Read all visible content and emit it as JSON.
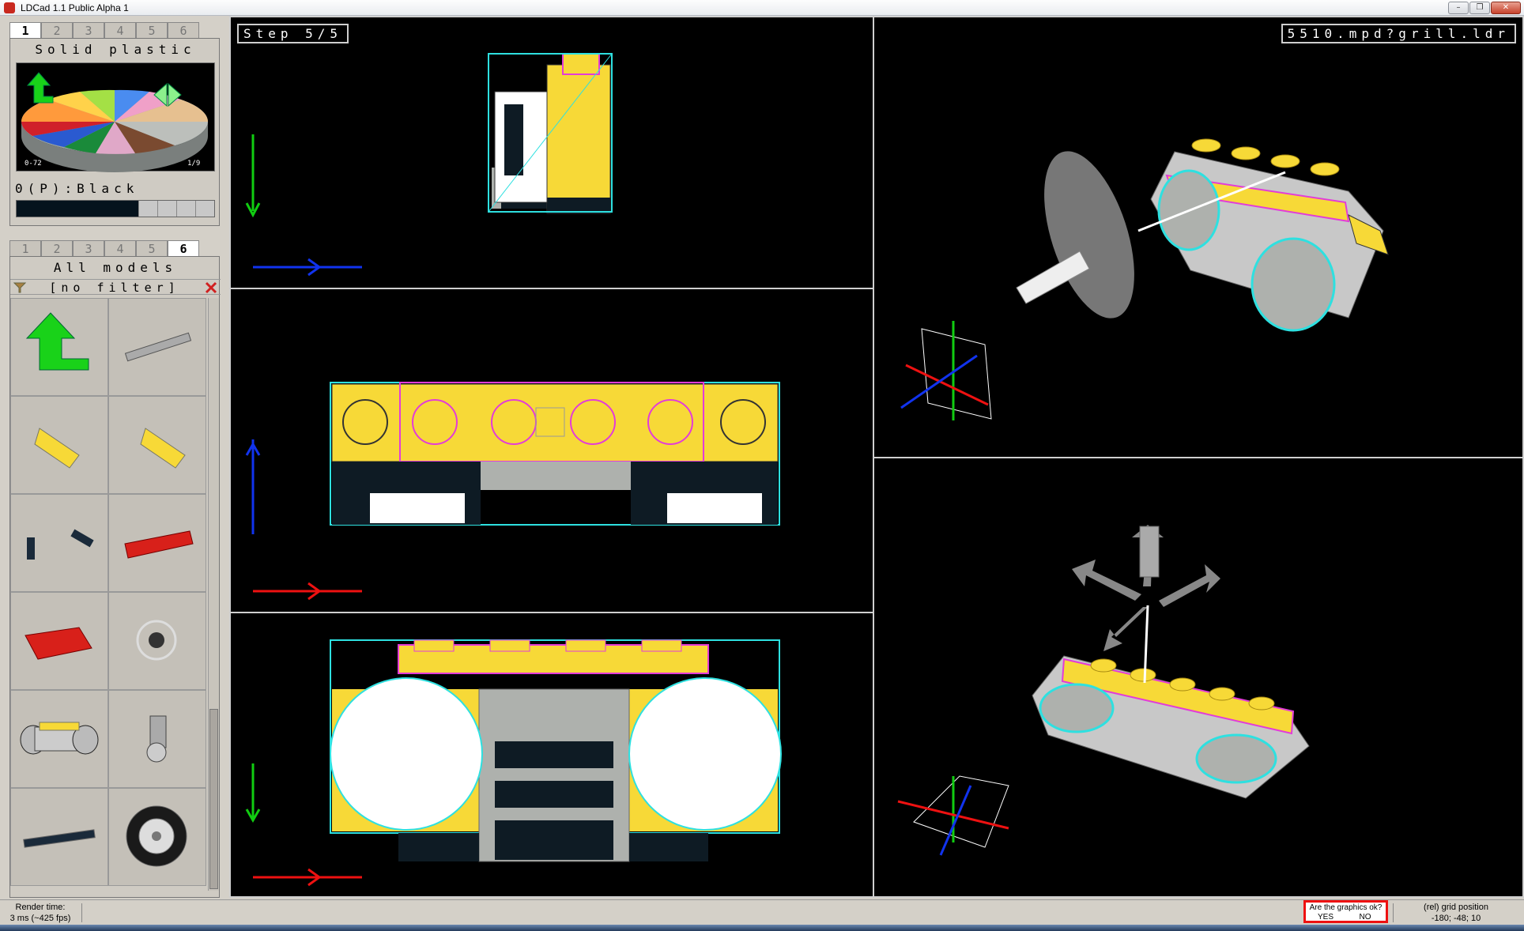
{
  "window": {
    "title": "LDCad 1.1 Public Alpha 1",
    "controls": [
      "–",
      "❐",
      "✕"
    ]
  },
  "color_panel": {
    "tabs": [
      "1",
      "2",
      "3",
      "4",
      "5",
      "6"
    ],
    "active_tab": "1",
    "heading": "Solid plastic",
    "range_label": "0-72",
    "page_label": "1/9",
    "current_color": "0(P):Black",
    "current_color_hex": "#05131d"
  },
  "parts_panel": {
    "tabs": [
      "1",
      "2",
      "3",
      "4",
      "5",
      "6"
    ],
    "active_tab": "6",
    "heading": "All models",
    "filter_text": "[no filter]",
    "items": [
      {
        "icon": "up-level-arrow-icon"
      },
      {
        "icon": "technic-beam-part-icon"
      },
      {
        "icon": "yellow-wedge-plate-left-icon"
      },
      {
        "icon": "yellow-wedge-plate-right-icon"
      },
      {
        "icon": "small-black-parts-icon"
      },
      {
        "icon": "red-plate-2x6-icon"
      },
      {
        "icon": "red-plate-4x6-icon"
      },
      {
        "icon": "wheel-assembly-icon"
      },
      {
        "icon": "grill-submodel-icon"
      },
      {
        "icon": "hinge-part-icon"
      },
      {
        "icon": "black-technic-axle-icon"
      },
      {
        "icon": "tire-wheel-icon"
      }
    ]
  },
  "viewports": {
    "top_left_label": "Step 5/5",
    "top_right_label": "5510.mpd?grill.ldr"
  },
  "colors": {
    "yellow": "#f7d937",
    "magenta": "#e33cd8",
    "cyan": "#2ee0e0",
    "gray": "#aeb1ad",
    "dark": "#0e1b24",
    "white": "#ffffff",
    "axis_red": "#ee1111",
    "axis_green": "#11cc11",
    "axis_blue": "#1133ee"
  },
  "statusbar": {
    "render_label": "Render time:",
    "render_value": "3 ms (~425 fps)",
    "graphics_question": "Are the graphics ok?",
    "yes": "YES",
    "no": "NO",
    "grid_label": "(rel) grid position",
    "grid_value": "-180; -48; 10"
  }
}
